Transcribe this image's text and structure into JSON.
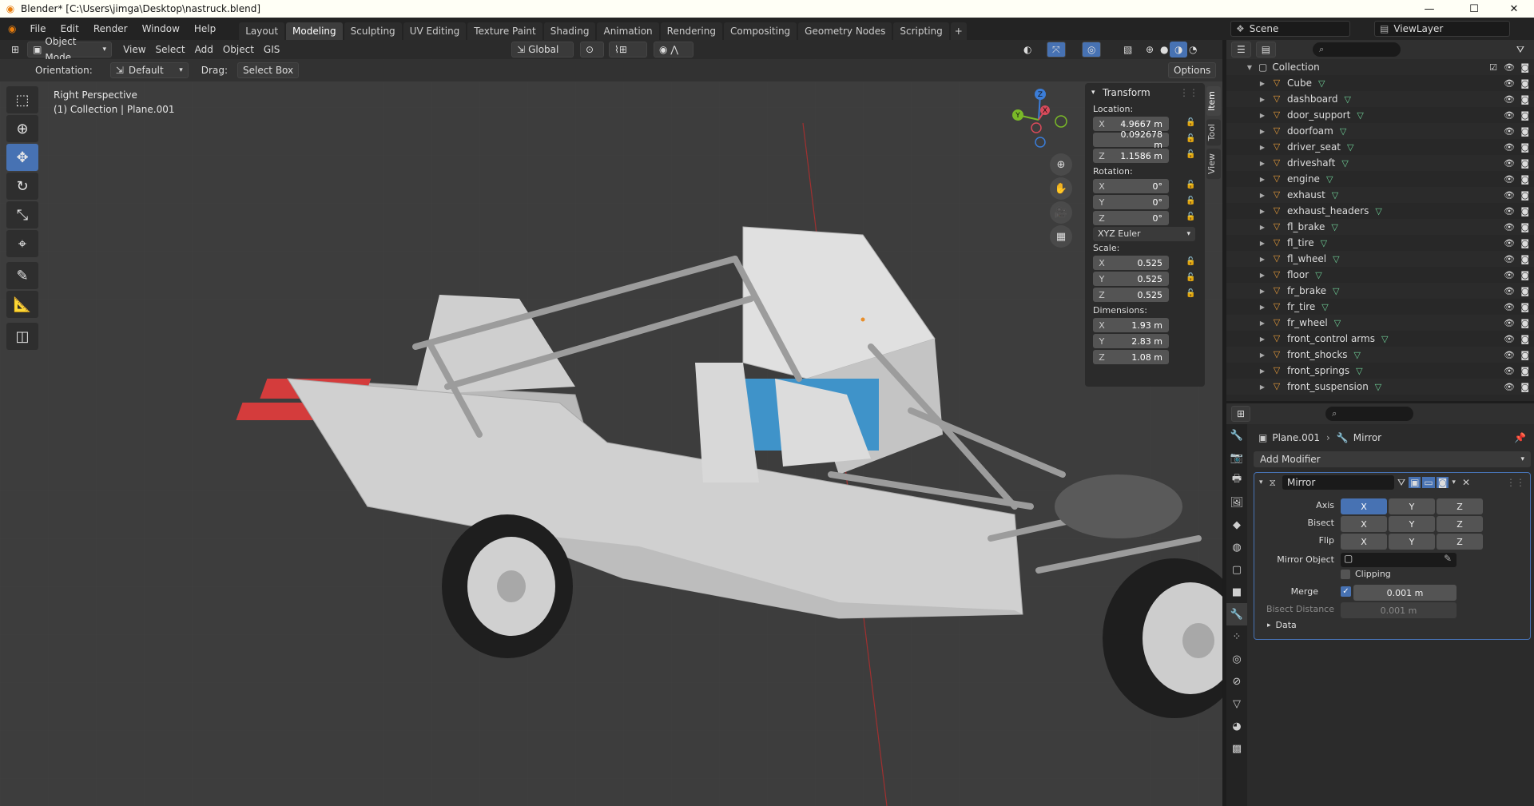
{
  "window": {
    "title": "Blender* [C:\\Users\\jimga\\Desktop\\nastruck.blend]",
    "minimize": "—",
    "maximize": "☐",
    "close": "✕"
  },
  "menu": [
    "File",
    "Edit",
    "Render",
    "Window",
    "Help"
  ],
  "workspaces": [
    {
      "label": "Layout",
      "active": false
    },
    {
      "label": "Modeling",
      "active": true
    },
    {
      "label": "Sculpting",
      "active": false
    },
    {
      "label": "UV Editing",
      "active": false
    },
    {
      "label": "Texture Paint",
      "active": false
    },
    {
      "label": "Shading",
      "active": false
    },
    {
      "label": "Animation",
      "active": false
    },
    {
      "label": "Rendering",
      "active": false
    },
    {
      "label": "Compositing",
      "active": false
    },
    {
      "label": "Geometry Nodes",
      "active": false
    },
    {
      "label": "Scripting",
      "active": false
    }
  ],
  "workspace_add": "+",
  "scene": "Scene",
  "view_layer": "ViewLayer",
  "viewport_header": {
    "mode": "Object Mode",
    "menus": [
      "View",
      "Select",
      "Add",
      "Object",
      "GIS"
    ],
    "orientation_global": "Global"
  },
  "tool_header": {
    "orientation_label": "Orientation:",
    "orientation_value": "Default",
    "drag_label": "Drag:",
    "drag_value": "Select Box",
    "options": "Options"
  },
  "viewport_info": {
    "view": "Right Perspective",
    "object": "(1) Collection | Plane.001"
  },
  "npanel": {
    "header": "Transform",
    "location_label": "Location:",
    "location": [
      {
        "axis": "X",
        "value": "4.9667 m"
      },
      {
        "axis": "",
        "value": "0.092678 m"
      },
      {
        "axis": "Z",
        "value": "1.1586 m"
      }
    ],
    "rotation_label": "Rotation:",
    "rotation": [
      {
        "axis": "X",
        "value": "0°"
      },
      {
        "axis": "Y",
        "value": "0°"
      },
      {
        "axis": "Z",
        "value": "0°"
      }
    ],
    "rotation_mode": "XYZ Euler",
    "scale_label": "Scale:",
    "scale": [
      {
        "axis": "X",
        "value": "0.525"
      },
      {
        "axis": "Y",
        "value": "0.525"
      },
      {
        "axis": "Z",
        "value": "0.525"
      }
    ],
    "dimensions_label": "Dimensions:",
    "dimensions": [
      {
        "axis": "X",
        "value": "1.93 m"
      },
      {
        "axis": "Y",
        "value": "2.83 m"
      },
      {
        "axis": "Z",
        "value": "1.08 m"
      }
    ],
    "tabs": [
      "Item",
      "Tool",
      "View"
    ]
  },
  "gizmo": {
    "z": "Z",
    "y": "Y",
    "x": "X"
  },
  "outliner": {
    "collection": "Collection",
    "items": [
      "Cube",
      "dashboard",
      "door_support",
      "doorfoam",
      "driver_seat",
      "driveshaft",
      "engine",
      "exhaust",
      "exhaust_headers",
      "fl_brake",
      "fl_tire",
      "fl_wheel",
      "floor",
      "fr_brake",
      "fr_tire",
      "fr_wheel",
      "front_control arms",
      "front_shocks",
      "front_springs",
      "front_suspension"
    ]
  },
  "properties": {
    "breadcrumb_object": "Plane.001",
    "breadcrumb_modifier": "Mirror",
    "add_modifier": "Add Modifier",
    "modifier_name": "Mirror",
    "axis_label": "Axis",
    "bisect_label": "Bisect",
    "flip_label": "Flip",
    "axis_buttons": [
      "X",
      "Y",
      "Z"
    ],
    "mirror_object_label": "Mirror Object",
    "clipping_label": "Clipping",
    "merge_label": "Merge",
    "merge_value": "0.001 m",
    "bisect_distance_label": "Bisect Distance",
    "bisect_distance_value": "0.001 m",
    "data_label": "Data"
  },
  "colors": {
    "accent": "#4772b3",
    "header": "#303030",
    "viewport": "#3d3d3d",
    "car_body": "#c8c8c8"
  }
}
